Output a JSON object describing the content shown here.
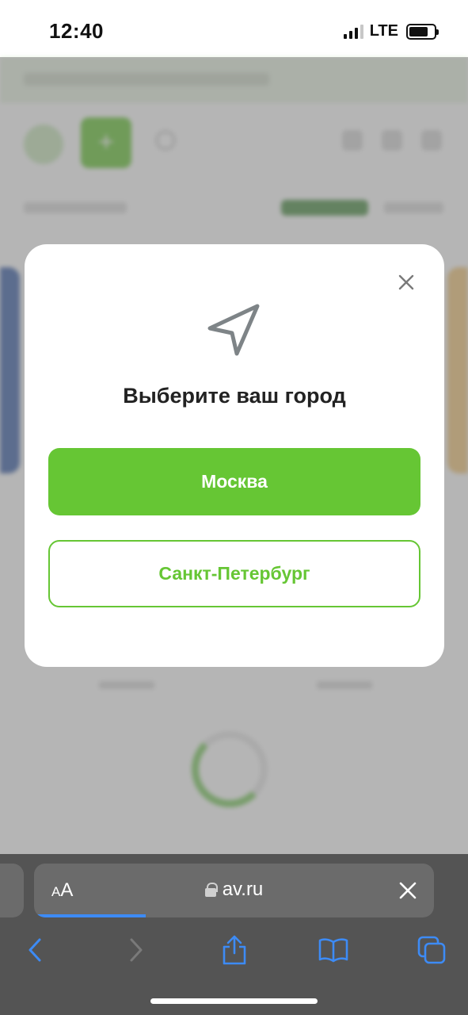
{
  "status_bar": {
    "time": "12:40",
    "network": "LTE",
    "battery_level": 0.75
  },
  "modal": {
    "title": "Выберите ваш город",
    "options": [
      {
        "label": "Москва",
        "style": "primary"
      },
      {
        "label": "Санкт-Петербург",
        "style": "outline"
      }
    ]
  },
  "safari": {
    "aa_label_small": "A",
    "aa_label_large": "A",
    "url": "av.ru",
    "load_progress": 0.28
  },
  "colors": {
    "accent": "#66c634",
    "ios_blue": "#3d8bf5",
    "overlay": "#787878"
  }
}
